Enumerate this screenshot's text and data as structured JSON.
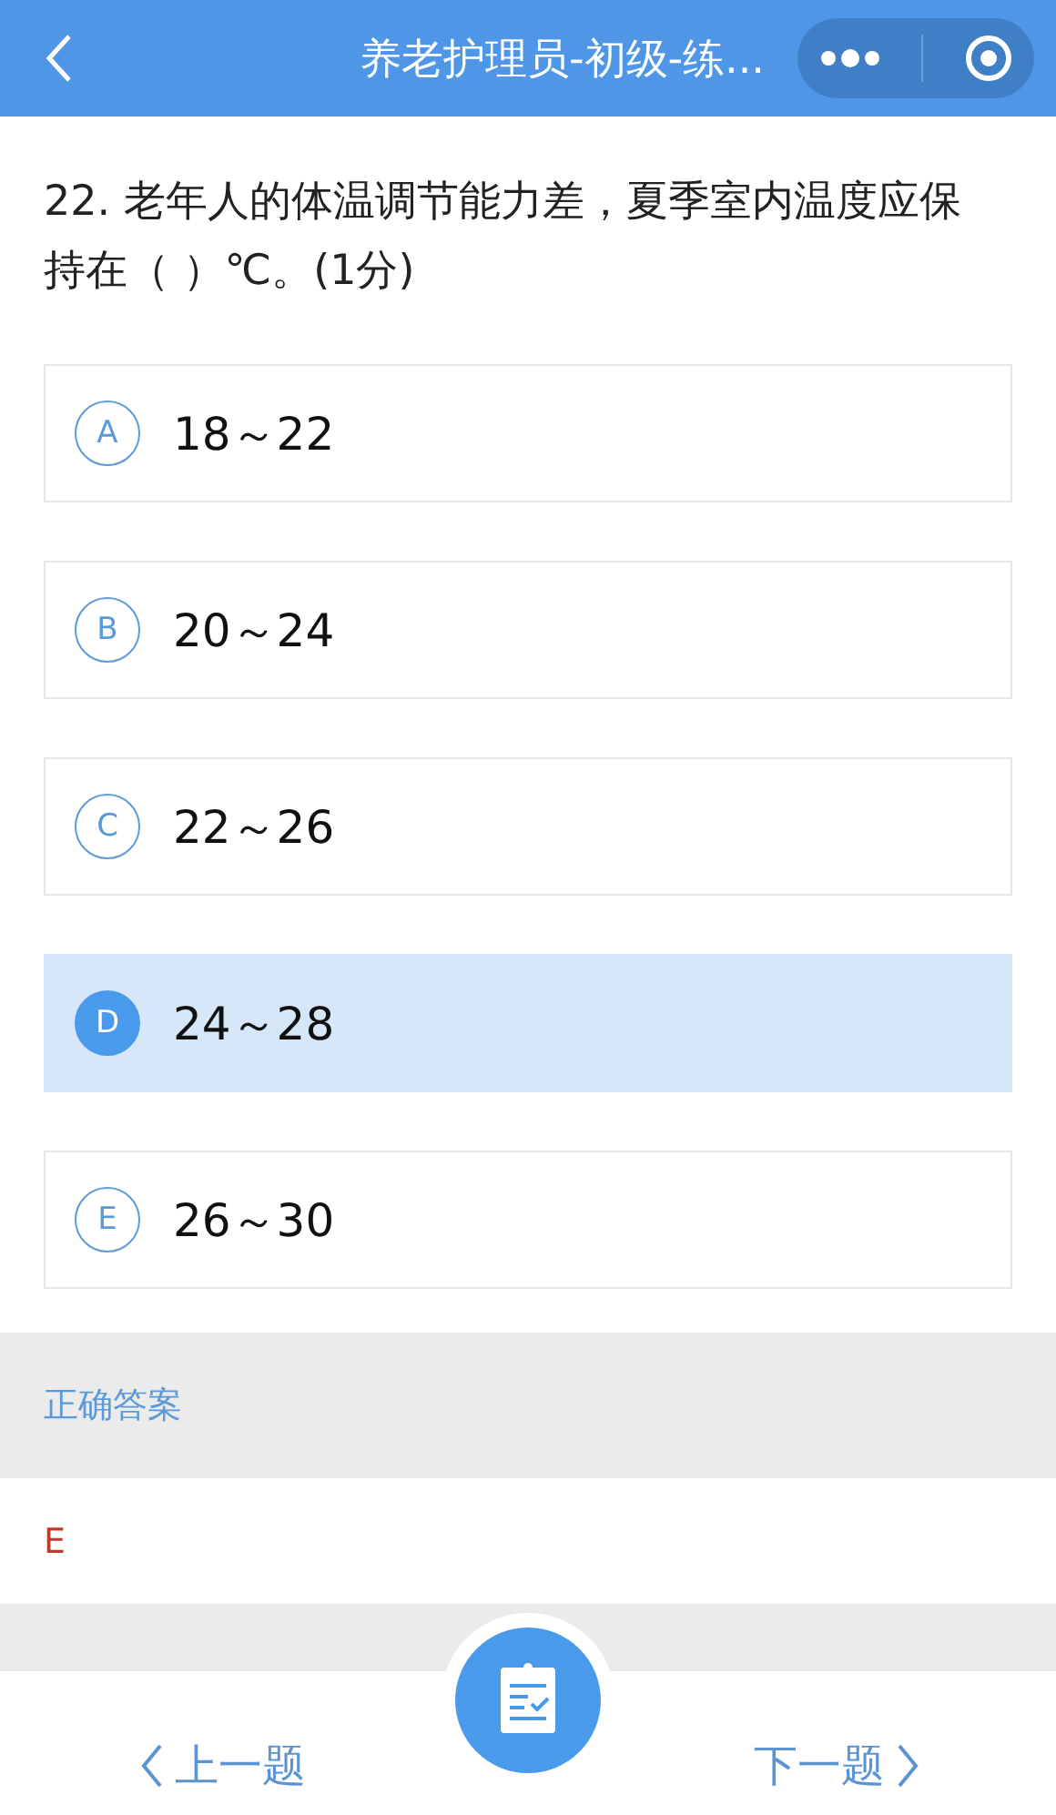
{
  "nav_bar": {
    "title": "养老护理员-初级-练..."
  },
  "question": {
    "text": "22. 老年人的体温调节能力差，夏季室内温度应保持在（ ）℃。(1分)"
  },
  "options": [
    {
      "letter": "A",
      "text": "18～22",
      "selected": false
    },
    {
      "letter": "B",
      "text": "20～24",
      "selected": false
    },
    {
      "letter": "C",
      "text": "22～26",
      "selected": false
    },
    {
      "letter": "D",
      "text": "24～28",
      "selected": true
    },
    {
      "letter": "E",
      "text": "26～30",
      "selected": false
    }
  ],
  "answer": {
    "heading": "正确答案",
    "value": "E"
  },
  "footer": {
    "prev": "上一题",
    "next": "下一题"
  }
}
